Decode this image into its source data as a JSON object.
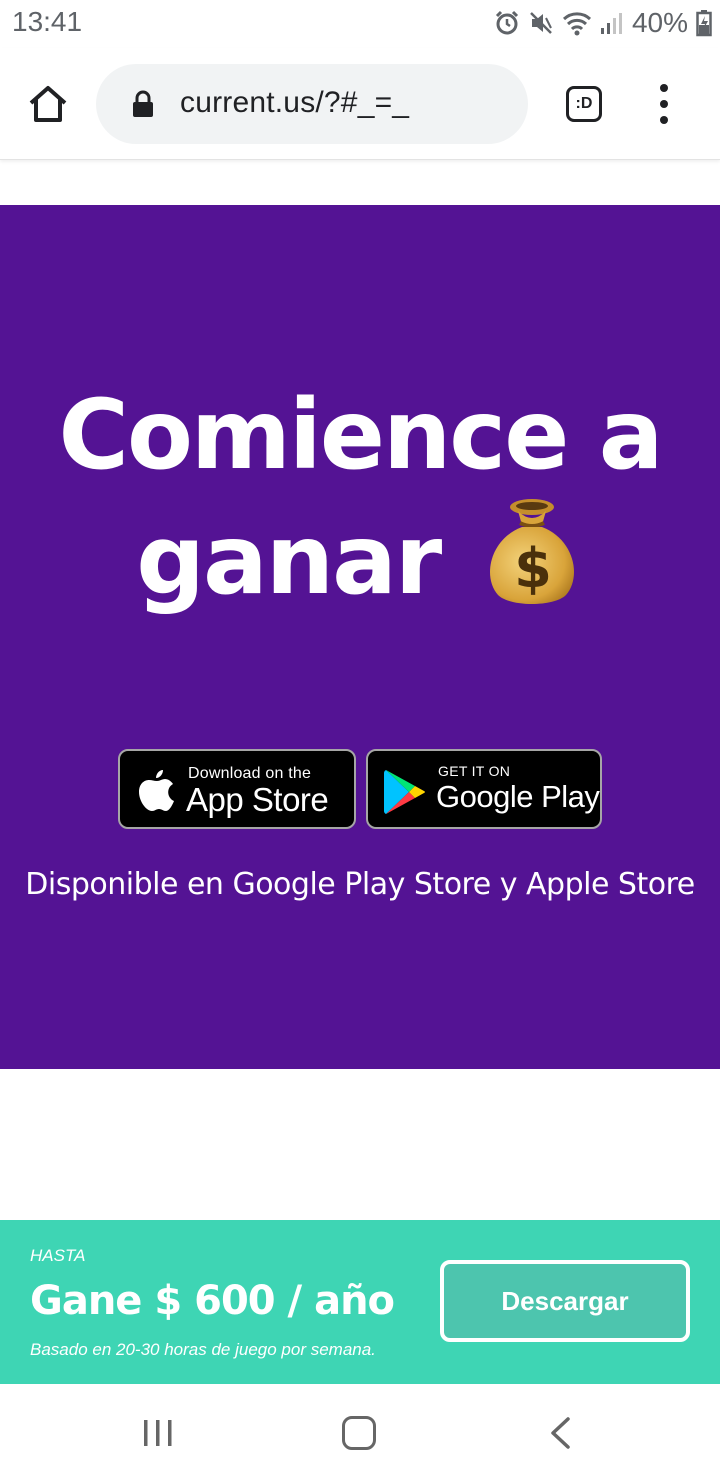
{
  "status_bar": {
    "time": "13:41",
    "battery": "40%"
  },
  "browser": {
    "url": "current.us/?#_=_",
    "tab_label": ":D"
  },
  "hero": {
    "title_line1": "Comience a",
    "title_line2": "ganar",
    "background_color": "#541394",
    "app_store_badge": {
      "small_text": "Download on the",
      "big_text": "App Store"
    },
    "google_play_badge": {
      "small_text": "GET IT ON",
      "big_text": "Google Play"
    },
    "available_text": "Disponible en Google Play Store y Apple Store"
  },
  "promo": {
    "label": "HASTA",
    "amount": "Gane $ 600 / año",
    "note": "Basado en 20-30 horas de juego por semana.",
    "button_label": "Descargar",
    "background_color": "#3ed5b4"
  }
}
